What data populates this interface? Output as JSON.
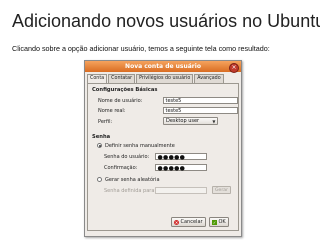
{
  "slide": {
    "title": "Adicionando novos usuários no Ubuntu",
    "caption": "Clicando sobre a opção adicionar usuário, temos a seguinte tela como resultado:"
  },
  "dialog": {
    "title": "Nova conta de usuário",
    "tabs": [
      "Conta",
      "Contatar",
      "Privilégios do usuário",
      "Avançado"
    ],
    "basic_section": "Configurações Básicas",
    "username_label": "Nome de usuário:",
    "username_value": "teste5",
    "realname_label": "Nome real:",
    "realname_value": "teste5",
    "profile_label": "Perfil:",
    "profile_value": "Desktop user",
    "password_section": "Senha",
    "manual_option": "Definir senha manualmente",
    "user_password_label": "Senha do usuário:",
    "user_password_value": "●●●●●",
    "confirm_label": "Confirmação:",
    "confirm_value": "●●●●●",
    "random_option": "Gerar senha aleatória",
    "defined_label": "Senha definida para:",
    "generate_button": "Gerar",
    "cancel_button": "Cancelar",
    "ok_button": "OK"
  },
  "colors": {
    "titlebar": "#e07b2c",
    "dialog_bg": "#efebe7"
  }
}
